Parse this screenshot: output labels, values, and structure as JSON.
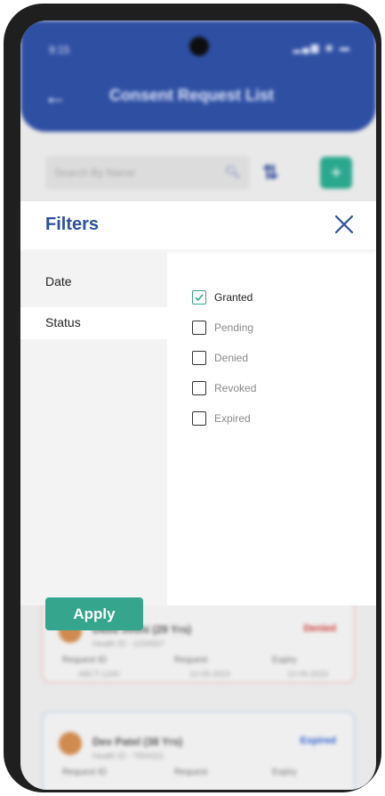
{
  "status_bar": {
    "time": "9:15",
    "icons": "▂▄▆ ◉ ▬"
  },
  "app_header": {
    "title": "Consent Request List"
  },
  "search": {
    "placeholder": "Search By Name"
  },
  "cards": [
    {
      "name": "Dasu Joshi (29 Yrs)",
      "sub": "Health ID - 1234567",
      "status": "Denied",
      "request_id_label": "Request ID",
      "request_id": "ABCT-1240",
      "request_label": "Request",
      "request_date": "10-09-2023",
      "expiry_label": "Expiry",
      "expiry_date": "10-09-2023"
    },
    {
      "name": "Dev Patel (38 Yrs)",
      "sub": "Health ID - 7654321",
      "status": "Expired",
      "request_id_label": "Request ID",
      "request_label": "Request",
      "expiry_label": "Expiry"
    }
  ],
  "filters": {
    "title": "Filters",
    "categories": [
      {
        "label": "Date"
      },
      {
        "label": "Status"
      }
    ],
    "status_options": [
      {
        "label": "Granted",
        "checked": true
      },
      {
        "label": "Pending",
        "checked": false
      },
      {
        "label": "Denied",
        "checked": false
      },
      {
        "label": "Revoked",
        "checked": false
      },
      {
        "label": "Expired",
        "checked": false
      }
    ],
    "apply_label": "Apply"
  },
  "colors": {
    "header": "#2f4fa3",
    "accent": "#35a58e",
    "title": "#2c4f9e"
  },
  "icons": {
    "back": "arrow-left-icon",
    "close": "close-icon",
    "search": "search-icon",
    "sort": "sort-icon",
    "add": "plus-icon"
  }
}
